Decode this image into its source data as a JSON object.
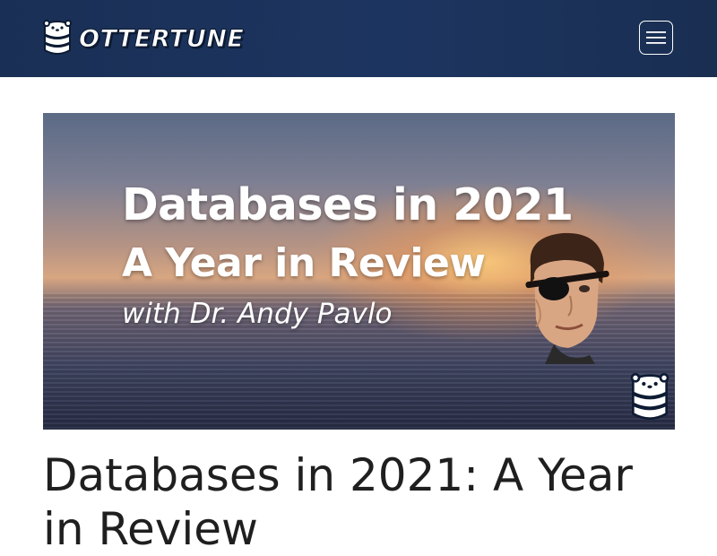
{
  "header": {
    "logo_text": "OTTERTUNE",
    "logo_icon": "otter-database-icon",
    "menu_icon": "hamburger-icon",
    "colors": {
      "background": "#1c3560",
      "foreground": "#ffffff"
    }
  },
  "hero": {
    "line1": "Databases in 2021",
    "line2": "A Year in Review",
    "line3": "with Dr. Andy Pavlo",
    "badge_icon": "otter-database-icon"
  },
  "article": {
    "title": "Databases in 2021: A Year in Review"
  }
}
